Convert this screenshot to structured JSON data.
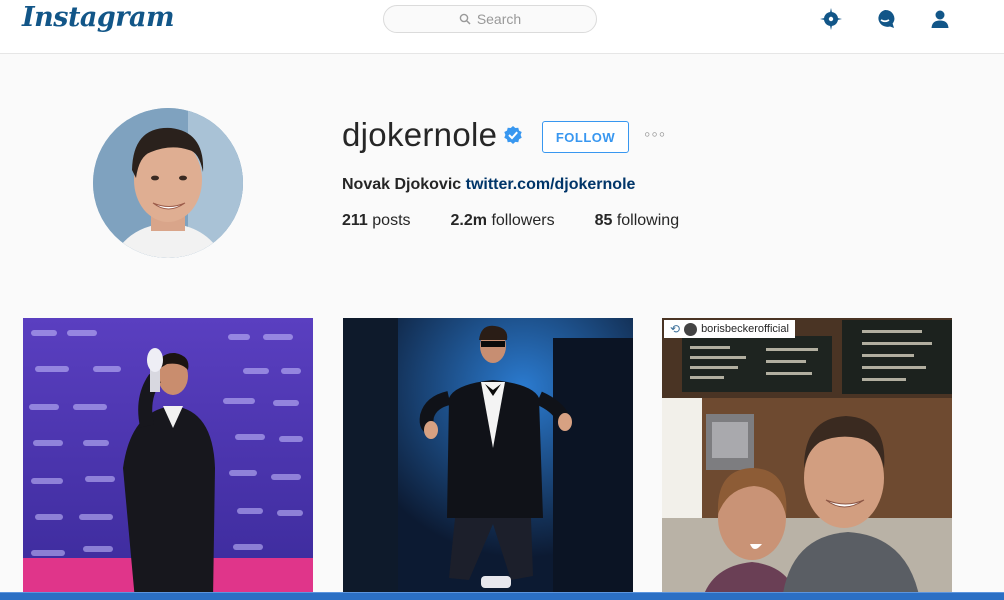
{
  "header": {
    "logo_text": "Instagram",
    "search_placeholder": "Search",
    "icons": [
      "compass-icon",
      "activity-bubble-icon",
      "user-profile-icon"
    ]
  },
  "profile": {
    "username": "djokernole",
    "verified": true,
    "follow_label": "FOLLOW",
    "more_label": "◦◦◦",
    "full_name": "Novak Djokovic",
    "bio_link": "twitter.com/djokernole",
    "stats": {
      "posts_count": "211",
      "posts_label": "posts",
      "followers_count": "2.2m",
      "followers_label": "followers",
      "following_count": "85",
      "following_label": "following"
    }
  },
  "posts": [
    {
      "description": "tuxedo-trophy-photo"
    },
    {
      "description": "bowtie-sunglasses-photo"
    },
    {
      "description": "cafe-selfie-photo",
      "repost_username": "borisbeckerofficial"
    }
  ],
  "colors": {
    "brand_blue": "#125688",
    "follow_blue": "#3897f0",
    "link_blue": "#003569",
    "verified_blue": "#3897f0"
  }
}
